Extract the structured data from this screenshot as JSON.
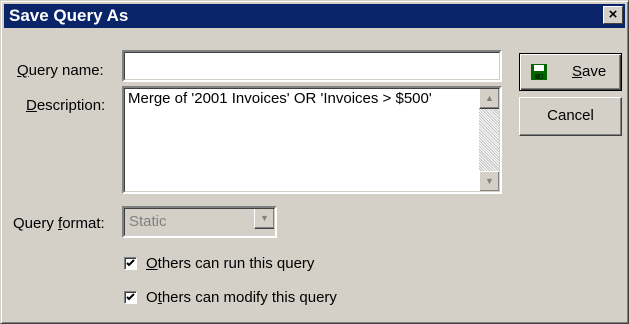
{
  "dialog": {
    "title": "Save Query As",
    "close_glyph": "×"
  },
  "form": {
    "query_name": {
      "label_mnemonic": "Q",
      "label_rest": "uery name:",
      "value": ""
    },
    "description": {
      "label_mnemonic": "D",
      "label_rest": "escription:",
      "value": "Merge of '2001 Invoices' OR 'Invoices > $500'"
    },
    "query_format": {
      "label_before": "Query ",
      "label_mnemonic": "f",
      "label_rest": "ormat:",
      "selected": "Static",
      "disabled": true
    },
    "checkboxes": [
      {
        "mnemonic": "O",
        "rest": "thers can run this query",
        "checked": true
      },
      {
        "before": "O",
        "mnemonic": "t",
        "rest": "hers can modify this query",
        "checked": true
      }
    ]
  },
  "buttons": {
    "save": {
      "mnemonic": "S",
      "rest": "ave",
      "icon": "floppy-disk-icon"
    },
    "cancel": {
      "label": "Cancel"
    }
  },
  "colors": {
    "titlebar": "#0a246a",
    "face": "#d4d0c8",
    "disabled_text": "#808080",
    "floppy_icon": "#006600"
  }
}
